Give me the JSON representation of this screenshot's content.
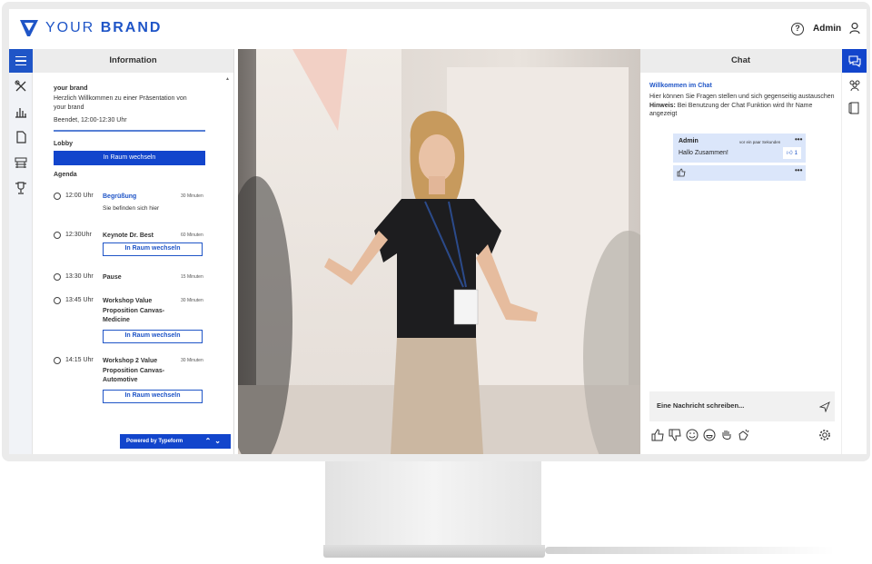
{
  "brand": {
    "name_light": "YOUR",
    "name_bold": "BRAND",
    "color": "#1f55c7"
  },
  "header": {
    "user_name": "Admin"
  },
  "info_panel": {
    "title": "Information",
    "brand_name": "your brand",
    "welcome": "Herzlich Willkommen zu einer Präsentation von your brand",
    "ended": "Beendet, 12:00-12:30 Uhr",
    "lobby_title": "Lobby",
    "lobby_button": "In Raum wechseln",
    "agenda_title": "Agenda",
    "agenda": [
      {
        "time": "12:00 Uhr",
        "title": "Begrüßung",
        "duration": "30 Minuten",
        "sub": "Sie befinden sich hier"
      },
      {
        "time": "12:30Uhr",
        "title": "Keynote Dr. Best",
        "duration": "60 Minuten",
        "button": "In Raum wechseln"
      },
      {
        "time": "13:30 Uhr",
        "title": "Pause",
        "duration": "15 Minuten"
      },
      {
        "time": "13:45 Uhr",
        "title": "Workshop Value Proposition Canvas-Medicine",
        "duration": "30 Minuten",
        "button": "In Raum wechseln"
      },
      {
        "time": "14:15 Uhr",
        "title": "Workshop 2 Value Proposition Canvas-Automotive",
        "duration": "30 Minuten",
        "button": "In Raum wechseln"
      }
    ],
    "typeform_label": "Powered by Typeform"
  },
  "chat": {
    "title": "Chat",
    "welcome": "Willkommen im Chat",
    "desc": "Hier können Sie Fragen stellen und sich gegenseitig austauschen",
    "hint_label": "Hinweis:",
    "hint": "Bei Benutzung der Chat Funktion wird Ihr Name angezeigt",
    "messages": [
      {
        "author": "Admin",
        "time": "vor ein paar Sekunden",
        "text": "Hallo Zusammen!",
        "likes": "1"
      }
    ],
    "input_placeholder": "Eine Nachricht schreiben..."
  },
  "icons": [
    "menu-icon",
    "tools-icon",
    "bar-chart-icon",
    "document-icon",
    "audience-icon",
    "trophy-icon",
    "chat-icon",
    "group-icon",
    "notebook-icon",
    "help-icon",
    "user-icon",
    "send-icon",
    "settings-icon"
  ]
}
